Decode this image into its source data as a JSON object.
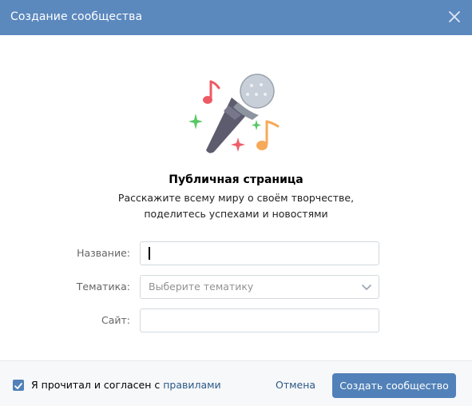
{
  "header": {
    "title": "Создание сообщества",
    "close_icon": "close-icon"
  },
  "content": {
    "heading": "Публичная страница",
    "subtitle_line1": "Расскажите всему миру о своём творчестве,",
    "subtitle_line2": "поделитесь успехами и новостями"
  },
  "form": {
    "name_label": "Название:",
    "name_value": "",
    "topic_label": "Тематика:",
    "topic_placeholder": "Выберите тематику",
    "site_label": "Сайт:",
    "site_value": ""
  },
  "footer": {
    "agree_checked": true,
    "agree_text": "Я прочитал и согласен с ",
    "agree_link": "правилами",
    "cancel_label": "Отмена",
    "create_label": "Создать сообщество"
  },
  "colors": {
    "header_bg": "#5b88bd",
    "primary": "#5181b8",
    "link": "#2a5885"
  }
}
